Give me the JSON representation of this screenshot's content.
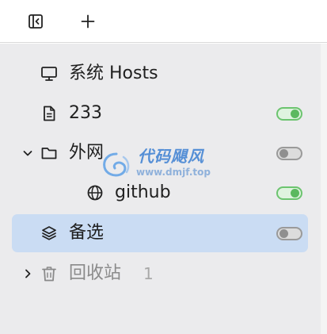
{
  "toolbar": {
    "toggle_sidebar_icon": "sidebar-toggle-icon",
    "add_icon": "plus-icon"
  },
  "sidebar": {
    "items": [
      {
        "label": "系统 Hosts",
        "icon": "monitor-icon",
        "toggle": null,
        "selected": false
      },
      {
        "label": "233",
        "icon": "document-icon",
        "toggle": "on",
        "selected": false
      },
      {
        "label": "外网",
        "icon": "folder-icon",
        "expanded": true,
        "toggle": "off",
        "selected": false
      },
      {
        "label": "github",
        "icon": "globe-icon",
        "toggle": "on",
        "selected": false
      },
      {
        "label": "备选",
        "icon": "layers-icon",
        "toggle": "off",
        "selected": true
      },
      {
        "label": "回收站",
        "icon": "trash-icon",
        "expanded": false,
        "count": "1",
        "selected": false
      }
    ]
  },
  "watermark": {
    "title": "代码飓风",
    "url": "www.dmjf.top"
  },
  "colors": {
    "toggle_on": "#5bb95f",
    "toggle_off": "#8f8f8f",
    "selected_row": "#cadcf3",
    "sidebar_bg": "#ebebed"
  }
}
